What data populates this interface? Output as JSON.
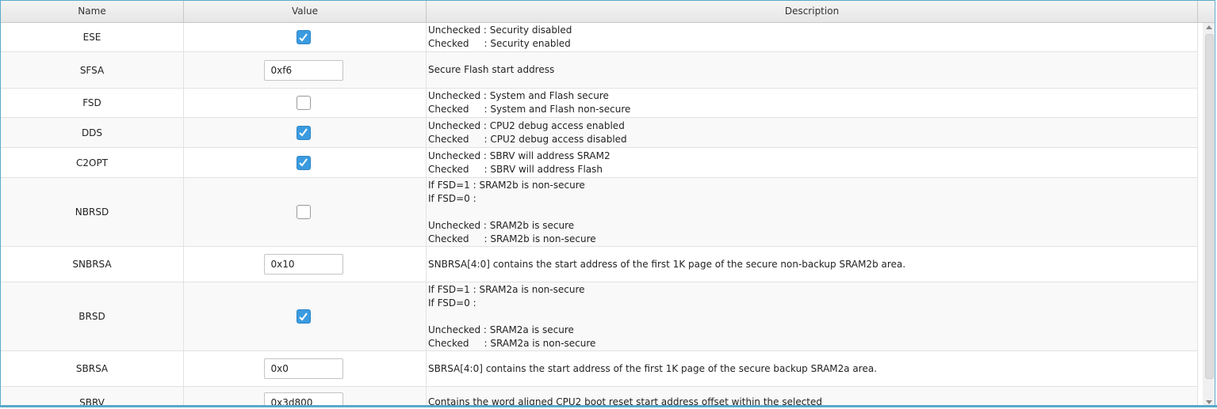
{
  "header": {
    "name": "Name",
    "value": "Value",
    "description": "Description"
  },
  "rows": [
    {
      "name": "ESE",
      "type": "checkbox",
      "checked": true,
      "description": [
        "Unchecked : Security disabled",
        "Checked     : Security enabled"
      ]
    },
    {
      "name": "SFSA",
      "type": "text",
      "value": "0xf6",
      "description": [
        "Secure Flash start address"
      ]
    },
    {
      "name": "FSD",
      "type": "checkbox",
      "checked": false,
      "description": [
        "Unchecked : System and Flash secure",
        "Checked     : System and Flash non-secure"
      ]
    },
    {
      "name": "DDS",
      "type": "checkbox",
      "checked": true,
      "description": [
        "Unchecked : CPU2 debug access enabled",
        "Checked     : CPU2 debug access disabled"
      ]
    },
    {
      "name": "C2OPT",
      "type": "checkbox",
      "checked": true,
      "description": [
        "Unchecked : SBRV will address SRAM2",
        "Checked     : SBRV will address Flash"
      ]
    },
    {
      "name": "NBRSD",
      "type": "checkbox",
      "checked": false,
      "description": [
        "If FSD=1 : SRAM2b is non-secure",
        "If FSD=0 :",
        "",
        "Unchecked : SRAM2b is secure",
        "Checked     : SRAM2b is non-secure"
      ]
    },
    {
      "name": "SNBRSA",
      "type": "text",
      "value": "0x10",
      "description": [
        "SNBRSA[4:0] contains the start address of the first 1K page of the secure non-backup SRAM2b area."
      ]
    },
    {
      "name": "BRSD",
      "type": "checkbox",
      "checked": true,
      "description": [
        "If FSD=1 : SRAM2a is non-secure",
        "If FSD=0 :",
        "",
        "Unchecked : SRAM2a is secure",
        "Checked     : SRAM2a is non-secure"
      ]
    },
    {
      "name": "SBRSA",
      "type": "text",
      "value": "0x0",
      "description": [
        "SBRSA[4:0] contains the start address of the first 1K page of the secure backup SRAM2a area."
      ]
    },
    {
      "name": "SBRV",
      "type": "text",
      "value": "0x3d800",
      "description": [
        "Contains the word aligned CPU2 boot reset start address offset within the selected"
      ]
    }
  ],
  "colors": {
    "accent": "#3b9be0",
    "border": "#5aa9c9"
  },
  "icons": {
    "check": "checkmark-icon",
    "scroll_up": "scroll-up-arrow-icon",
    "scroll_down": "scroll-down-arrow-icon"
  }
}
